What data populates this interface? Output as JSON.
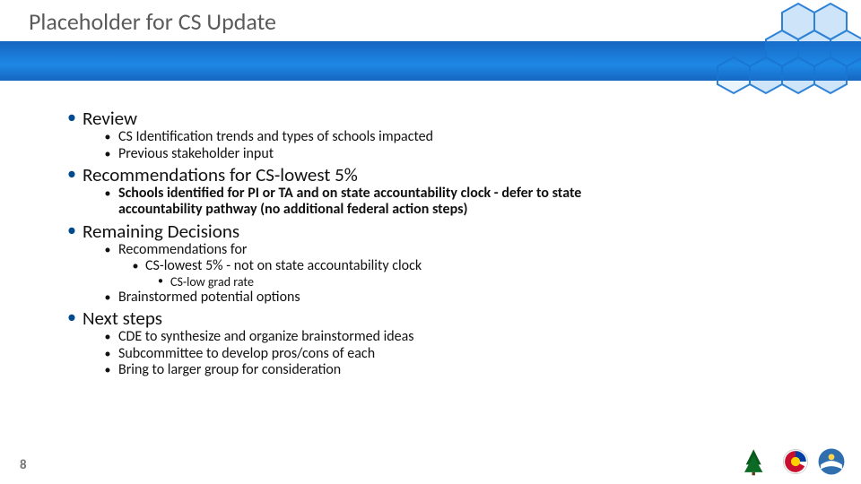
{
  "title": "Placeholder for CS Update",
  "page_number": "8",
  "sections": [
    {
      "label": "Review",
      "bold": false,
      "level2": [
        {
          "text": "CS Identification trends and types of schools impacted",
          "bold": false
        },
        {
          "text": "Previous stakeholder input",
          "bold": false
        }
      ]
    },
    {
      "label": "Recommendations for CS-lowest 5%",
      "bold": true,
      "level2": [
        {
          "text": "Schools identified for PI or TA and on state accountability clock - defer to state accountability pathway (no additional federal action steps)",
          "bold": true
        }
      ]
    },
    {
      "label": "Remaining Decisions",
      "bold": false,
      "level2": [
        {
          "text": "Recommendations for",
          "bold": false,
          "level3": [
            {
              "text": "CS-lowest 5% - not on state accountability clock",
              "bold": false
            },
            {
              "text": "CS-low grad rate",
              "small": true
            }
          ]
        },
        {
          "text": "Brainstormed potential options",
          "bold": false
        }
      ]
    },
    {
      "label": "Next steps",
      "bold": false,
      "level2": [
        {
          "text": "CDE to synthesize and organize brainstormed ideas",
          "bold": false
        },
        {
          "text": "Subcommittee to develop pros/cons of each",
          "bold": false
        },
        {
          "text": "Bring to larger group for consideration",
          "bold": false
        }
      ]
    }
  ]
}
